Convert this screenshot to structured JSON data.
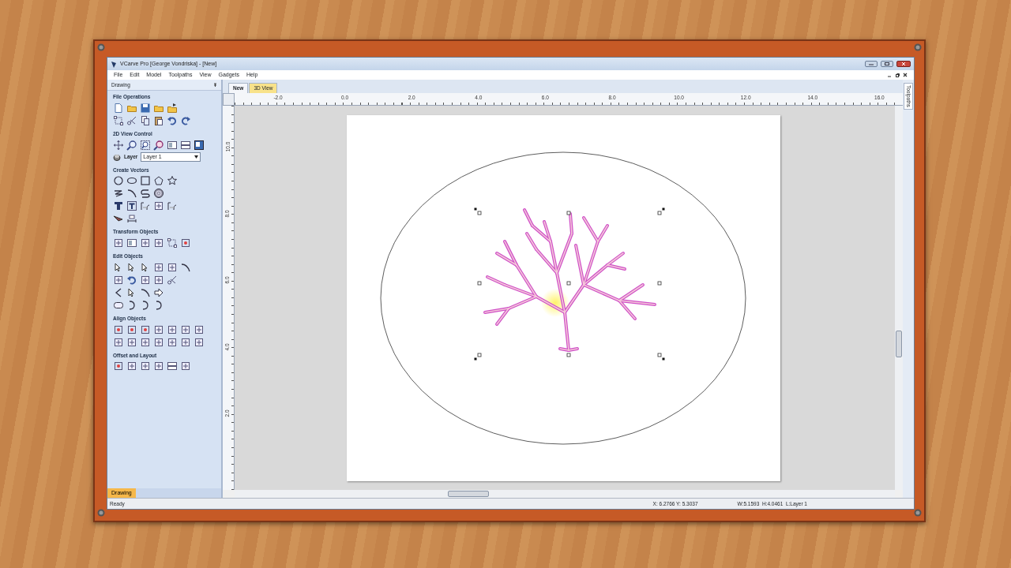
{
  "window": {
    "title": "VCarve Pro [George Vondriska] - [New]"
  },
  "menu": [
    "File",
    "Edit",
    "Model",
    "Toolpaths",
    "View",
    "Gadgets",
    "Help"
  ],
  "left_panel": {
    "title": "Drawing",
    "sections": [
      {
        "title": "File Operations"
      },
      {
        "title": "2D View Control",
        "layer": {
          "label": "Layer",
          "value": "Layer 1"
        }
      },
      {
        "title": "Create Vectors"
      },
      {
        "title": "Transform Objects"
      },
      {
        "title": "Edit Objects"
      },
      {
        "title": "Align Objects"
      },
      {
        "title": "Offset and Layout"
      }
    ],
    "bottom_tabs": [
      {
        "label": "Drawing",
        "selected": true
      }
    ]
  },
  "document_tabs": [
    {
      "label": "New",
      "selected": true
    },
    {
      "label": "3D View",
      "selected": false
    }
  ],
  "rulers": {
    "horizontal": [
      "-2.0",
      "0.0",
      "2.0",
      "4.0",
      "6.0",
      "8.0",
      "10.0",
      "12.0",
      "14.0",
      "16.0"
    ],
    "vertical": [
      "10.0",
      "8.0",
      "6.0",
      "4.0",
      "2.0"
    ]
  },
  "side_tab": "Toolpaths",
  "status_bar": {
    "message": "Ready",
    "position": "X: 6.2766 Y: 5.3037",
    "size": "W:5.1593  H:4.0461  L:Layer 1"
  }
}
